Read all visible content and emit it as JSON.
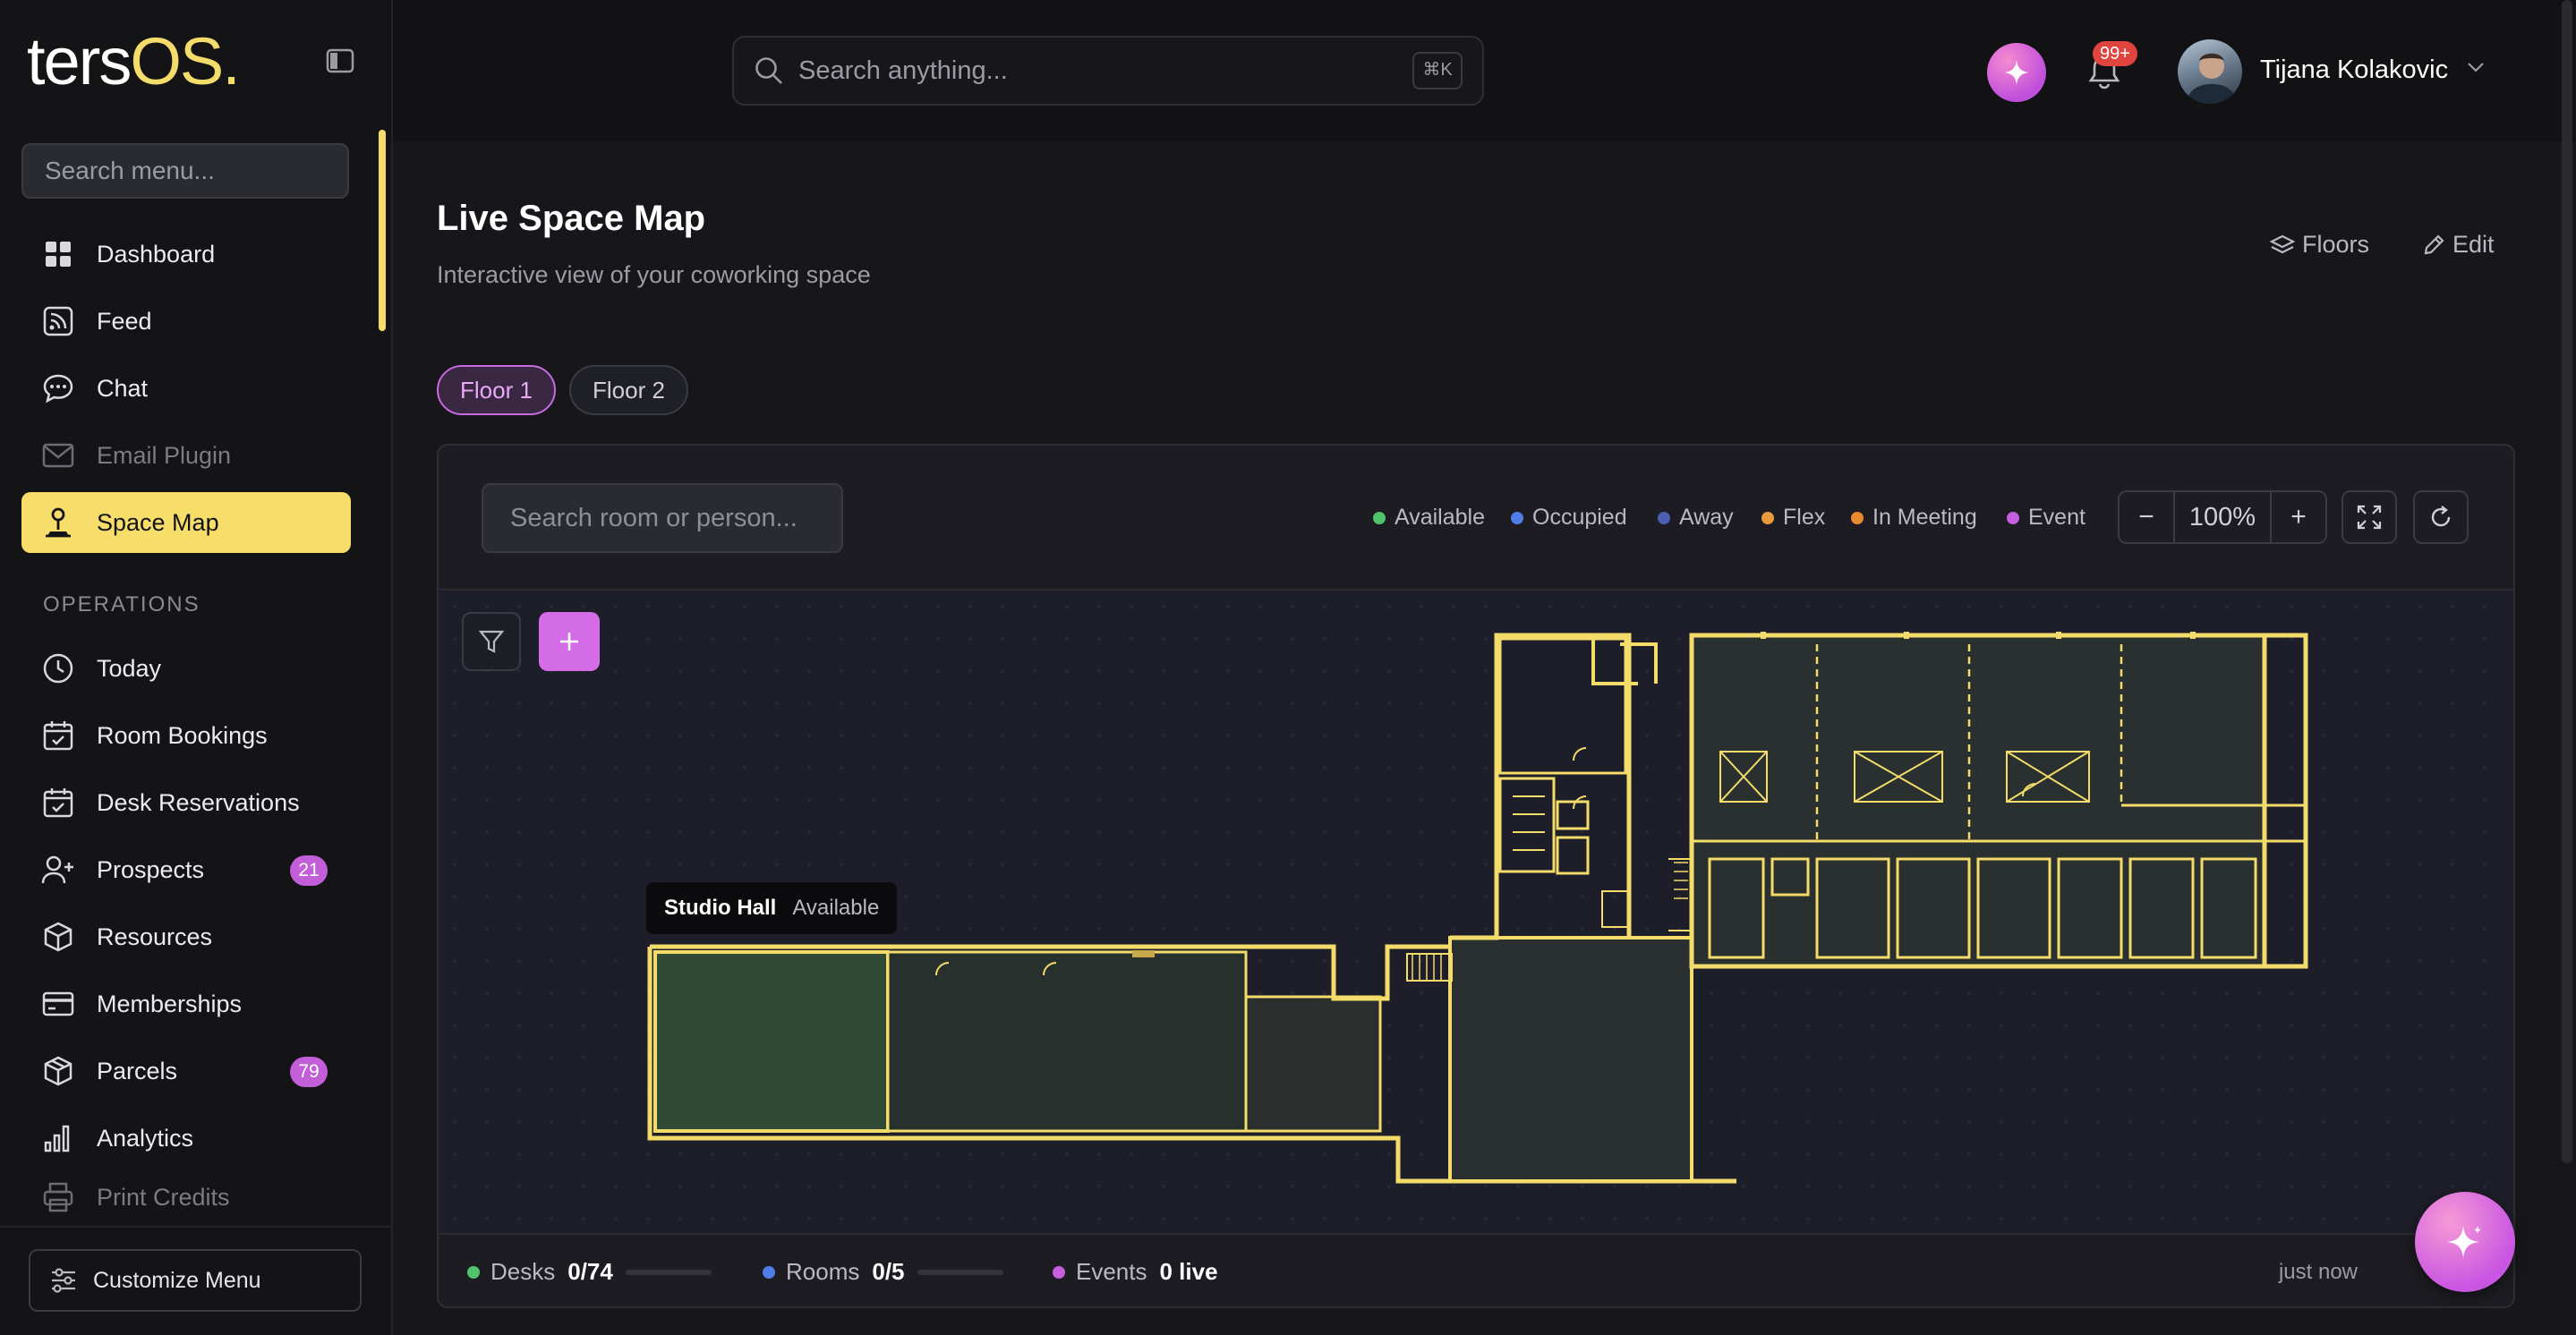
{
  "app": {
    "logo_main": "ters",
    "logo_accent": "OS."
  },
  "sidebar": {
    "search_placeholder": "Search menu...",
    "items": [
      {
        "label": "Dashboard",
        "icon": "grid-icon"
      },
      {
        "label": "Feed",
        "icon": "rss-icon"
      },
      {
        "label": "Chat",
        "icon": "chat-icon"
      },
      {
        "label": "Email Plugin",
        "icon": "mail-icon",
        "dimmed": true
      },
      {
        "label": "Space Map",
        "icon": "person-pin-icon",
        "active": true
      }
    ],
    "section_operations": "OPERATIONS",
    "ops_items": [
      {
        "label": "Today",
        "icon": "clock-icon"
      },
      {
        "label": "Room Bookings",
        "icon": "calendar-check-icon"
      },
      {
        "label": "Desk Reservations",
        "icon": "calendar-check-icon"
      },
      {
        "label": "Prospects",
        "icon": "user-plus-icon",
        "badge": "21"
      },
      {
        "label": "Resources",
        "icon": "box-icon"
      },
      {
        "label": "Memberships",
        "icon": "card-icon"
      },
      {
        "label": "Parcels",
        "icon": "package-icon",
        "badge": "79"
      },
      {
        "label": "Analytics",
        "icon": "bar-chart-icon"
      },
      {
        "label": "Print Credits",
        "icon": "printer-icon",
        "dimmed": true
      }
    ],
    "customize_label": "Customize Menu"
  },
  "topbar": {
    "search_placeholder": "Search anything...",
    "search_shortcut": "⌘K",
    "notifications_badge": "99+",
    "user_name": "Tijana Kolakovic"
  },
  "page": {
    "title": "Live Space Map",
    "subtitle": "Interactive view of your coworking space",
    "floors_button": "Floors",
    "edit_button": "Edit",
    "floor_tabs": [
      {
        "label": "Floor 1",
        "active": true
      },
      {
        "label": "Floor 2",
        "active": false
      }
    ]
  },
  "map": {
    "search_placeholder": "Search room or person...",
    "legend": [
      {
        "label": "Available",
        "color": "#4fc46a"
      },
      {
        "label": "Occupied",
        "color": "#4f7ee8"
      },
      {
        "label": "Away",
        "color": "#4a5fb0"
      },
      {
        "label": "Flex",
        "color": "#e89a3c"
      },
      {
        "label": "In Meeting",
        "color": "#e88a2e"
      },
      {
        "label": "Event",
        "color": "#c65ee0"
      }
    ],
    "zoom": "100%",
    "zoom_out": "−",
    "zoom_in": "+",
    "tooltip": {
      "room": "Studio Hall",
      "status": "Available"
    },
    "footer": {
      "desks_label": "Desks",
      "desks_value": "0/74",
      "rooms_label": "Rooms",
      "rooms_value": "0/5",
      "events_label": "Events",
      "events_value": "0 live",
      "updated": "just now"
    }
  },
  "colors": {
    "accent": "#f7de6b",
    "brand_purple": "#c65ee0",
    "wall": "#f4dc6b"
  }
}
